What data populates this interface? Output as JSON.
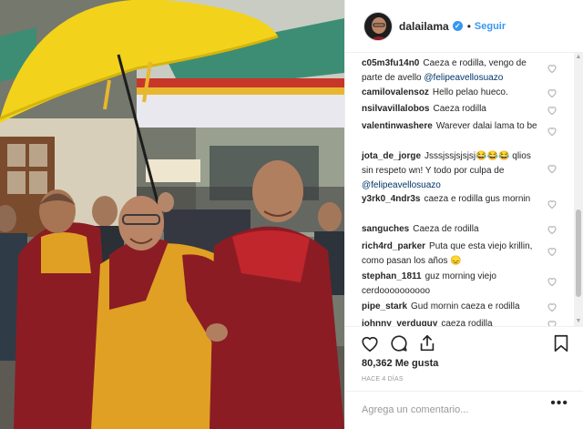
{
  "post": {
    "photo_description": "",
    "header": {
      "username": "dalailama",
      "verified_icon": "verified-badge-icon",
      "separator": "•",
      "follow_label": "Seguir"
    },
    "comments": [
      {
        "username": "c05m3fu14n0",
        "text": "Caeza e rodilla, vengo de parte de avello",
        "mention": "@felipeavellosuazo"
      },
      {
        "username": "camilovalensoz",
        "text": "Hello pelao hueco.",
        "mention": ""
      },
      {
        "username": "nsilvavillalobos",
        "text": "Caeza rodilla",
        "mention": ""
      },
      {
        "username": "valentinwashere",
        "text": "Warever dalai lama to be",
        "mention": ""
      },
      {
        "username": "jota_de_jorge",
        "text": "Jsssjssjsjsjsj😂😂😂 qlios sin respeto wn! Y todo por culpa de",
        "mention": "@felipeavellosuazo"
      },
      {
        "username": "y3rk0_4ndr3s",
        "text": "caeza e rodilla gus mornin",
        "mention": ""
      },
      {
        "username": "sanguches",
        "text": "Caeza de rodilla",
        "mention": ""
      },
      {
        "username": "rich4rd_parker",
        "text": "Puta que esta viejo krillin, como pasan los años 😞",
        "mention": ""
      },
      {
        "username": "stephan_1811",
        "text": "guz morning viejo cerdoooooooooo",
        "mention": ""
      },
      {
        "username": "pipe_stark",
        "text": "Gud mornin caeza e rodilla",
        "mention": ""
      },
      {
        "username": "johnny_verduguy",
        "text": "caeza rodilla",
        "mention": ""
      }
    ],
    "actions": {
      "like_icon": "heart-icon",
      "comment_icon": "comment-bubble-icon",
      "share_icon": "share-icon",
      "save_icon": "bookmark-icon"
    },
    "likes_count": "80,362",
    "likes_label": "Me gusta",
    "time_ago": "HACE 4 DÍAS",
    "comment_placeholder": "Agrega un comentario...",
    "more_options": "•••"
  },
  "colors": {
    "link_blue": "#3897f0",
    "mention_navy": "#003569",
    "muted_gray": "#999999",
    "umbrella_yellow": "#f2d21b",
    "robe_maroon": "#8b1c24",
    "robe_saffron": "#e0a024"
  }
}
